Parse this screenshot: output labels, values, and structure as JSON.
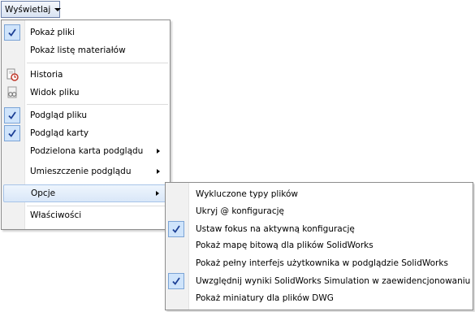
{
  "menu_button": {
    "label": "Wyświetlaj",
    "icon": "chevron-down-icon"
  },
  "main_menu": {
    "items": [
      {
        "label": "Pokaż pliki",
        "checked": true
      },
      {
        "label": "Pokaż listę materiałów",
        "checked": false
      },
      {
        "label": "Historia",
        "icon": "history-icon"
      },
      {
        "label": "Widok pliku",
        "icon": "file-view-icon"
      },
      {
        "label": "Podgląd pliku",
        "checked": true
      },
      {
        "label": "Podgląd karty",
        "checked": true
      },
      {
        "label": "Podzielona karta podglądu",
        "submenu": true
      },
      {
        "label": "Umieszczenie podglądu",
        "submenu": true
      },
      {
        "label": "Opcje",
        "submenu": true,
        "highlighted": true
      },
      {
        "label": "Właściwości"
      }
    ]
  },
  "options_submenu": {
    "items": [
      {
        "label": "Wykluczone typy plików",
        "checked": false
      },
      {
        "label": "Ukryj @ konfigurację",
        "checked": false
      },
      {
        "label": "Ustaw fokus na aktywną konfigurację",
        "checked": true
      },
      {
        "label": "Pokaż mapę bitową dla plików SolidWorks",
        "checked": false
      },
      {
        "label": "Pokaż pełny interfejs użytkownika w podglądzie SolidWorks",
        "checked": false
      },
      {
        "label": "Uwzględnij wyniki SolidWorks Simulation w zaewidencjonowaniu",
        "checked": true
      },
      {
        "label": "Pokaż miniatury dla plików DWG",
        "checked": false
      }
    ]
  },
  "colors": {
    "check": "#1c3f95",
    "highlight": "#d9e7f8",
    "border": "#8c8c8c"
  }
}
